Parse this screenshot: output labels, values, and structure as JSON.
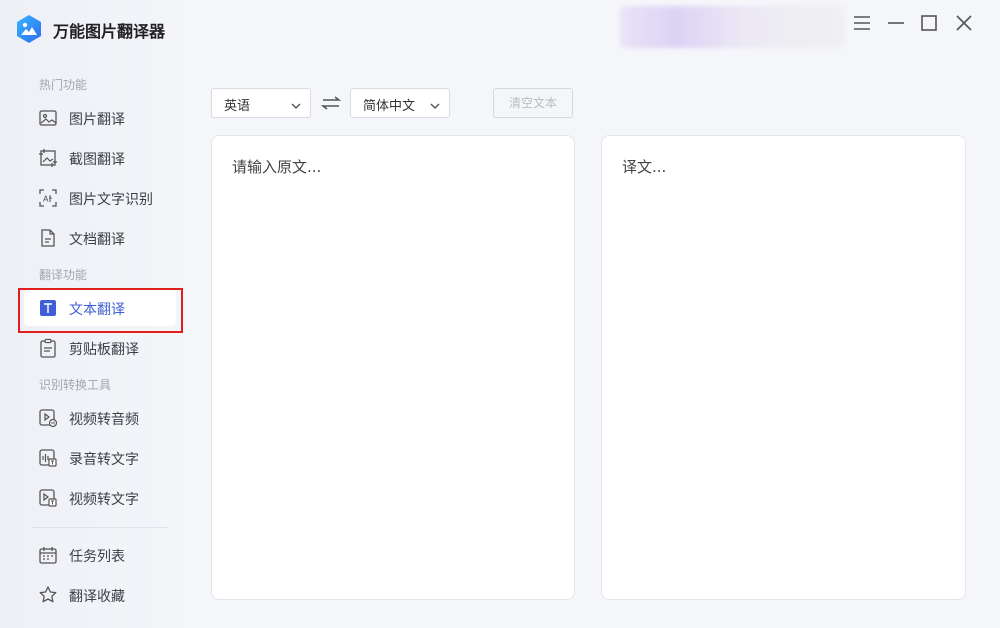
{
  "app": {
    "title": "万能图片翻译器"
  },
  "sidebar": {
    "sections": [
      {
        "label": "热门功能"
      },
      {
        "label": "翻译功能"
      },
      {
        "label": "识别转换工具"
      }
    ],
    "items": [
      {
        "label": "图片翻译",
        "icon": "image-icon"
      },
      {
        "label": "截图翻译",
        "icon": "screenshot-icon"
      },
      {
        "label": "图片文字识别",
        "icon": "ocr-icon"
      },
      {
        "label": "文档翻译",
        "icon": "document-icon"
      },
      {
        "label": "文本翻译",
        "icon": "text-icon",
        "active": true
      },
      {
        "label": "剪贴板翻译",
        "icon": "clipboard-icon"
      },
      {
        "label": "视频转音频",
        "icon": "video-audio-icon"
      },
      {
        "label": "录音转文字",
        "icon": "audio-text-icon"
      },
      {
        "label": "视频转文字",
        "icon": "video-text-icon"
      },
      {
        "label": "任务列表",
        "icon": "calendar-icon"
      },
      {
        "label": "翻译收藏",
        "icon": "star-icon"
      }
    ]
  },
  "toolbar": {
    "source_lang": "英语",
    "target_lang": "简体中文",
    "clear_label": "清空文本"
  },
  "editor": {
    "source_placeholder": "请输入原文...",
    "target_placeholder": "译文..."
  },
  "colors": {
    "accent": "#3f5fd6",
    "highlight": "#e0201e"
  }
}
